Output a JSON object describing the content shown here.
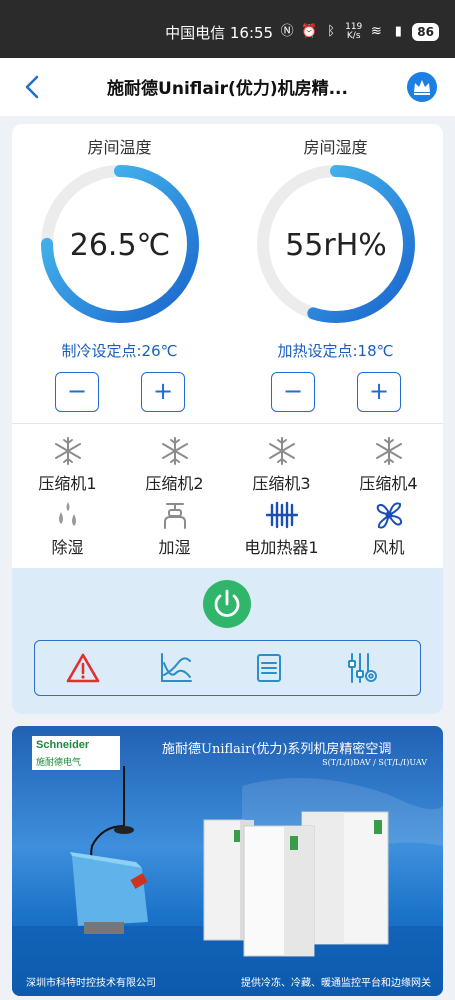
{
  "status_bar": {
    "carrier_time": "中国电信 16:55",
    "net_speed_value": "119",
    "net_speed_unit": "K/s",
    "battery": "86"
  },
  "header": {
    "title": "施耐德Uniflair(优力)机房精..."
  },
  "climate": {
    "temperature": {
      "label": "房间温度",
      "value": "26.5℃",
      "fill_fraction": 0.75,
      "setpoint": "制冷设定点:26℃"
    },
    "humidity": {
      "label": "房间湿度",
      "value": "55rH%",
      "fill_fraction": 0.55,
      "setpoint": "加热设定点:18℃"
    },
    "minus_label": "−",
    "plus_label": "+"
  },
  "components": [
    {
      "label": "压缩机1",
      "icon": "snowflake-icon"
    },
    {
      "label": "压缩机2",
      "icon": "snowflake-icon"
    },
    {
      "label": "压缩机3",
      "icon": "snowflake-icon"
    },
    {
      "label": "压缩机4",
      "icon": "snowflake-icon"
    },
    {
      "label": "除湿",
      "icon": "droplets-icon"
    },
    {
      "label": "加湿",
      "icon": "humidifier-icon"
    },
    {
      "label": "电加热器1",
      "icon": "heater-icon"
    },
    {
      "label": "风机",
      "icon": "fan-icon"
    }
  ],
  "toolbar": {
    "icons": [
      "alarm-icon",
      "chart-icon",
      "list-icon",
      "settings-sliders-icon"
    ]
  },
  "banner": {
    "logo_brand": "Schneider",
    "logo_cn": "施耐德电气",
    "title": "施耐德Uniflair(优力)系列机房精密空调",
    "models": "S(T/L/I)DAV / S(T/L/I)UAV",
    "footer_left": "深圳市科特时控技术有限公司",
    "footer_right": "提供冷冻、冷藏、暖通监控平台和边缘网关"
  },
  "colors": {
    "accent": "#1f6fd0",
    "gauge_start": "#1a64cc",
    "gauge_end": "#4dc6f4",
    "power_green": "#2fb66a",
    "alarm_red": "#e03030"
  }
}
